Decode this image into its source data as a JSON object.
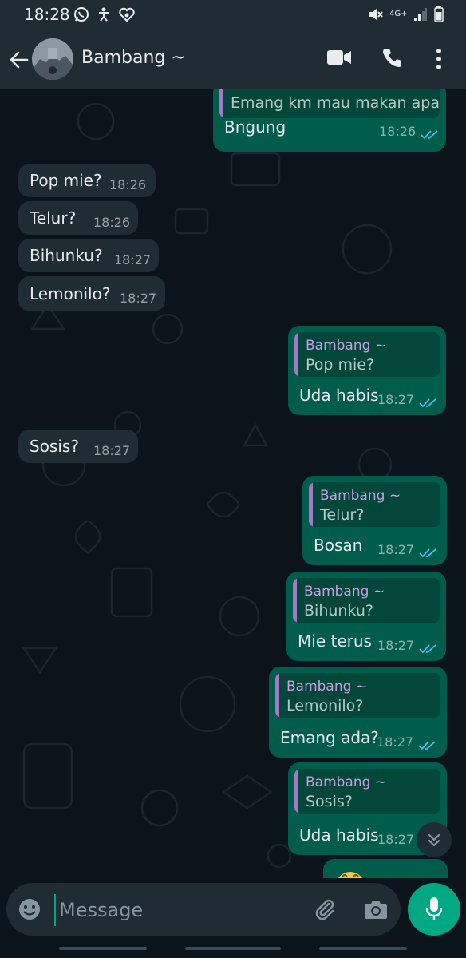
{
  "status_bar": {
    "time": "18:28",
    "network": "4G+",
    "left_icons": [
      "whatsapp-status-icon",
      "accessibility-icon",
      "heart-hands-icon"
    ],
    "right_icons": [
      "mute-icon",
      "network-icon",
      "signal-icon",
      "battery-icon"
    ]
  },
  "header": {
    "contact_name": "Bambang ~",
    "icons": [
      "back-arrow-icon",
      "video-call-icon",
      "voice-call-icon",
      "more-menu-icon"
    ]
  },
  "messages": [
    {
      "dir": "out",
      "quote_text": "Emang km mau makan apa?",
      "text": "Bngung",
      "time": "18:26",
      "ticks": "read"
    },
    {
      "dir": "in",
      "text": "Pop mie?",
      "time": "18:26"
    },
    {
      "dir": "in",
      "text": "Telur?",
      "time": "18:26"
    },
    {
      "dir": "in",
      "text": "Bihunku?",
      "time": "18:27"
    },
    {
      "dir": "in",
      "text": "Lemonilo?",
      "time": "18:27"
    },
    {
      "dir": "out",
      "quote_author": "Bambang ~",
      "quote_text": "Pop mie?",
      "text": "Uda habis",
      "time": "18:27",
      "ticks": "read"
    },
    {
      "dir": "in",
      "text": "Sosis?",
      "time": "18:27"
    },
    {
      "dir": "out",
      "quote_author": "Bambang ~",
      "quote_text": "Telur?",
      "text": "Bosan",
      "time": "18:27",
      "ticks": "read"
    },
    {
      "dir": "out",
      "quote_author": "Bambang ~",
      "quote_text": "Bihunku?",
      "text": "Mie terus",
      "time": "18:27",
      "ticks": "read"
    },
    {
      "dir": "out",
      "quote_author": "Bambang ~",
      "quote_text": "Lemonilo?",
      "text": "Emang ada?",
      "time": "18:27",
      "ticks": "read"
    },
    {
      "dir": "out",
      "quote_author": "Bambang ~",
      "quote_text": "Sosis?",
      "text": "Uda habis",
      "time": "18:27",
      "ticks": "read"
    },
    {
      "dir": "out",
      "text": "",
      "emoji": "sweat-smile-emoji",
      "partially_visible": true
    }
  ],
  "composer": {
    "placeholder": "Message",
    "icons": [
      "emoji-icon",
      "attach-icon",
      "camera-icon",
      "microphone-icon"
    ]
  },
  "colors": {
    "background": "#0b141a",
    "header": "#1f2c34",
    "incoming_bubble": "#202c33",
    "outgoing_bubble": "#005c4b",
    "accent": "#00a884",
    "read_ticks": "#53bdeb",
    "quote_author": "#c79ee6"
  }
}
